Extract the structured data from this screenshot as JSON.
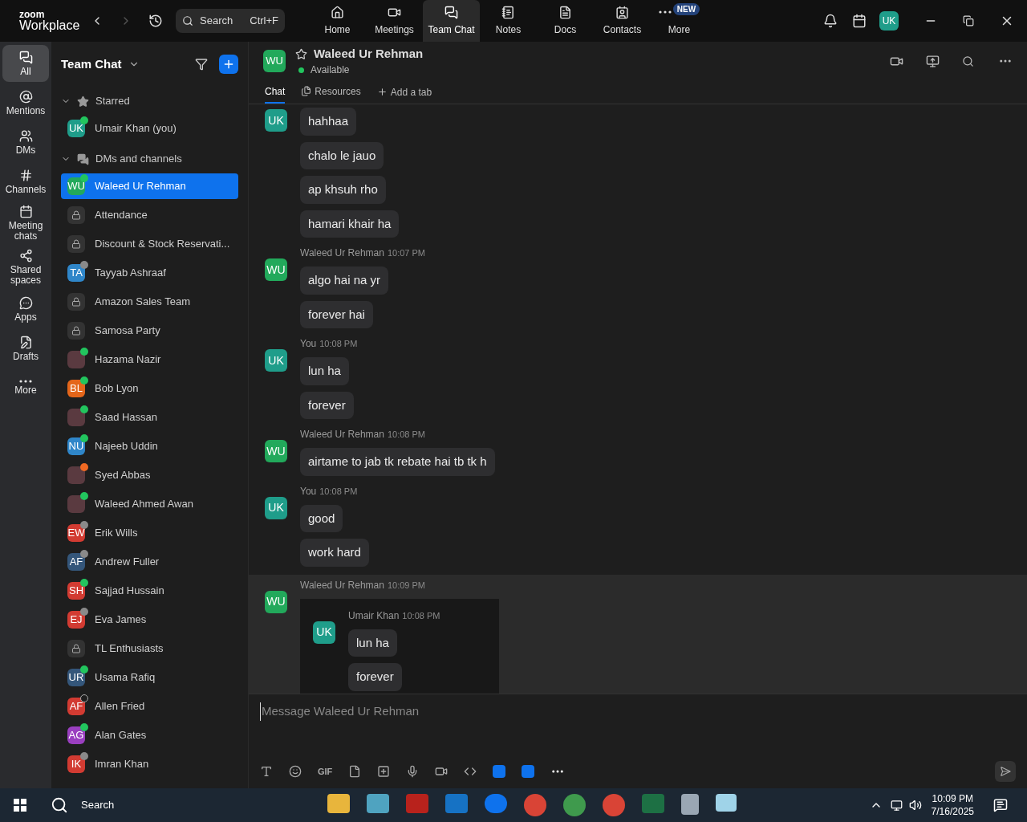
{
  "topbar": {
    "logo_top": "zoom",
    "logo_bottom": "Workplace",
    "search": {
      "placeholder": "Search",
      "shortcut": "Ctrl+F"
    },
    "nav": [
      {
        "label": "Home",
        "selected": false
      },
      {
        "label": "Meetings",
        "selected": false
      },
      {
        "label": "Team Chat",
        "selected": true
      },
      {
        "label": "Notes",
        "selected": false
      },
      {
        "label": "Docs",
        "selected": false
      },
      {
        "label": "Contacts",
        "selected": false
      },
      {
        "label": "More",
        "selected": false,
        "badge": "NEW"
      }
    ],
    "avatar": "UK"
  },
  "rail": [
    {
      "label": "All",
      "selected": true
    },
    {
      "label": "Mentions",
      "selected": false
    },
    {
      "label": "DMs",
      "selected": false
    },
    {
      "label": "Channels",
      "selected": false
    },
    {
      "label": "Meeting chats",
      "selected": false
    },
    {
      "label": "Shared spaces",
      "selected": false
    },
    {
      "label": "Apps",
      "selected": false
    },
    {
      "label": "Drafts",
      "selected": false
    },
    {
      "label": "More",
      "selected": false
    }
  ],
  "sidebar": {
    "title": "Team Chat",
    "sections": [
      {
        "label": "Starred",
        "expanded": true,
        "items": [
          {
            "kind": "person",
            "name": "Umair Khan (you)",
            "initials": "UK",
            "color": "#1f9d8a",
            "dot": {
              "kind": "filled",
              "color": "#22c55e"
            },
            "selected": false
          }
        ]
      },
      {
        "label": "DMs and channels",
        "expanded": true,
        "items": [
          {
            "kind": "person",
            "name": "Waleed Ur Rehman",
            "initials": "WU",
            "color": "#22a95b",
            "dot": {
              "kind": "filled",
              "color": "#22c55e"
            },
            "selected": true
          },
          {
            "kind": "channel",
            "name": "Attendance",
            "selected": false
          },
          {
            "kind": "channel",
            "name": "Discount & Stock Reservati...",
            "selected": false
          },
          {
            "kind": "person",
            "name": "Tayyab Ashraaf",
            "initials": "TA",
            "color": "#2f86c9",
            "dot": {
              "kind": "filled",
              "color": "#8a8a8a"
            },
            "selected": false
          },
          {
            "kind": "channel",
            "name": "Amazon Sales Team",
            "selected": false
          },
          {
            "kind": "channel",
            "name": "Samosa Party",
            "selected": false
          },
          {
            "kind": "photo",
            "name": "Hazama Nazir",
            "dot": {
              "kind": "filled",
              "color": "#22c55e"
            },
            "selected": false
          },
          {
            "kind": "person",
            "name": "Bob Lyon",
            "initials": "BL",
            "color": "#e4661a",
            "dot": {
              "kind": "filled",
              "color": "#22c55e"
            },
            "selected": false
          },
          {
            "kind": "photo",
            "name": "Saad Hassan",
            "dot": {
              "kind": "filled",
              "color": "#22c55e"
            },
            "selected": false
          },
          {
            "kind": "person",
            "name": "Najeeb Uddin",
            "initials": "NU",
            "color": "#2f86c9",
            "dot": {
              "kind": "filled",
              "color": "#22c55e"
            },
            "selected": false
          },
          {
            "kind": "photo",
            "name": "Syed Abbas",
            "dot": {
              "kind": "filled",
              "color": "#f06a23"
            },
            "selected": false
          },
          {
            "kind": "photo",
            "name": "Waleed Ahmed Awan",
            "dot": {
              "kind": "filled",
              "color": "#22c55e"
            },
            "selected": false
          },
          {
            "kind": "person",
            "name": "Erik Wills",
            "initials": "EW",
            "color": "#d23b32",
            "dot": {
              "kind": "filled",
              "color": "#8a8a8a"
            },
            "selected": false
          },
          {
            "kind": "person",
            "name": "Andrew Fuller",
            "initials": "AF",
            "color": "#34567a",
            "dot": {
              "kind": "filled",
              "color": "#8a8a8a"
            },
            "selected": false
          },
          {
            "kind": "person",
            "name": "Sajjad Hussain",
            "initials": "SH",
            "color": "#d23b32",
            "dot": {
              "kind": "filled",
              "color": "#22c55e"
            },
            "selected": false
          },
          {
            "kind": "person",
            "name": "Eva James",
            "initials": "EJ",
            "color": "#d23b32",
            "dot": {
              "kind": "filled",
              "color": "#8a8a8a"
            },
            "selected": false
          },
          {
            "kind": "channel",
            "name": "TL Enthusiasts",
            "selected": false
          },
          {
            "kind": "person",
            "name": "Usama Rafiq",
            "initials": "UR",
            "color": "#34567a",
            "dot": {
              "kind": "filled",
              "color": "#22c55e"
            },
            "selected": false
          },
          {
            "kind": "person",
            "name": "Allen Fried",
            "initials": "AF",
            "color": "#d23b32",
            "dot": {
              "kind": "ring",
              "color": "#aaaaaa"
            },
            "selected": false
          },
          {
            "kind": "person",
            "name": "Alan Gates",
            "initials": "AG",
            "color": "#9a3fc0",
            "dot": {
              "kind": "filled",
              "color": "#22c55e"
            },
            "selected": false
          },
          {
            "kind": "person",
            "name": "Imran Khan",
            "initials": "IK",
            "color": "#d23b32",
            "dot": {
              "kind": "filled",
              "color": "#8a8a8a"
            },
            "selected": false
          }
        ]
      }
    ]
  },
  "chat": {
    "initials": "WU",
    "name": "Waleed Ur Rehman",
    "presence": "Available",
    "tabs": [
      {
        "label": "Chat",
        "selected": true
      },
      {
        "label": "Resources",
        "selected": false
      }
    ],
    "add_tab": "Add a tab",
    "groups": [
      {
        "initials": "UK",
        "color": "#1f9d8a",
        "highlighted": false,
        "messages": [
          "hahhaa",
          "chalo le jauo",
          "ap khsuh rho",
          "hamari khair ha"
        ]
      },
      {
        "initials": "WU",
        "color": "#22a95b",
        "sender": "Waleed Ur Rehman",
        "time": "10:07 PM",
        "highlighted": false,
        "messages": [
          "algo hai na yr",
          "forever hai"
        ]
      },
      {
        "initials": "UK",
        "color": "#1f9d8a",
        "sender": "You",
        "time": "10:08 PM",
        "highlighted": false,
        "messages": [
          "lun ha",
          "forever"
        ]
      },
      {
        "initials": "WU",
        "color": "#22a95b",
        "sender": "Waleed Ur Rehman",
        "time": "10:08 PM",
        "highlighted": false,
        "messages": [
          "airtame to jab tk rebate hai tb tk h"
        ]
      },
      {
        "initials": "UK",
        "color": "#1f9d8a",
        "sender": "You",
        "time": "10:08 PM",
        "highlighted": false,
        "messages": [
          "good",
          "work hard"
        ]
      },
      {
        "initials": "WU",
        "color": "#22a95b",
        "sender": "Waleed Ur Rehman",
        "time": "10:09 PM",
        "highlighted": true,
        "quote": {
          "initials": "UK",
          "color": "#1f9d8a",
          "sender": "Umair Khan",
          "time": "10:08 PM",
          "messages": [
            "lun ha",
            "forever"
          ]
        }
      }
    ],
    "composer": {
      "placeholder": "Message Waleed Ur Rehman",
      "gif": "GIF"
    }
  },
  "taskbar": {
    "search": "Search",
    "time": "10:09 PM",
    "date": "7/16/2025"
  }
}
